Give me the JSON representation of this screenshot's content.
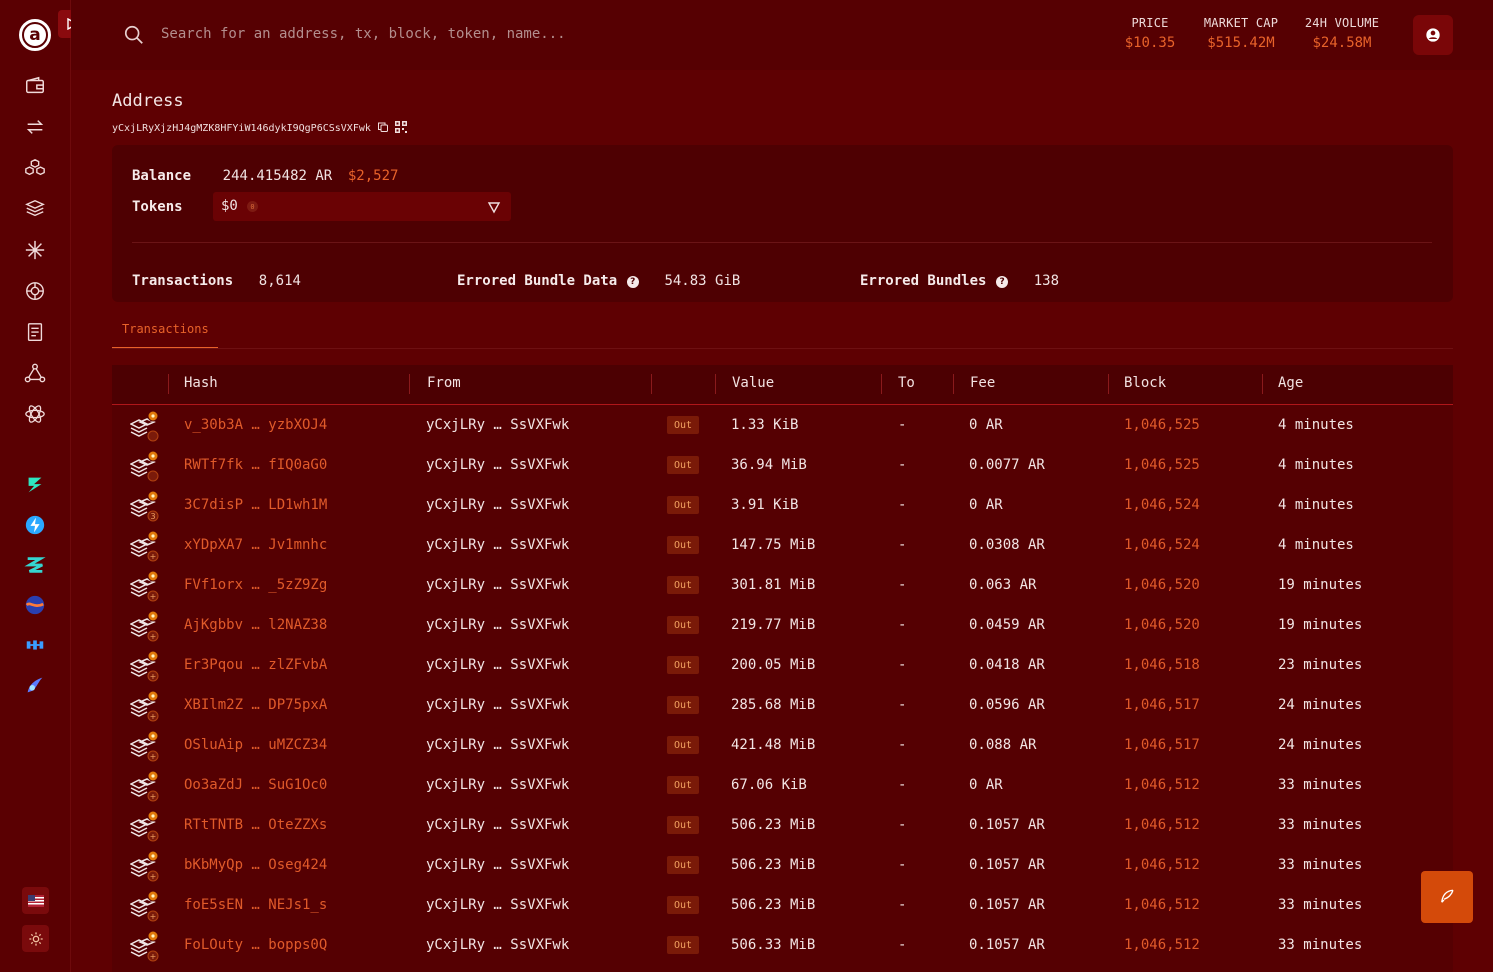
{
  "header": {
    "search_placeholder": "Search for an address, tx, block, token, name...",
    "stats": [
      {
        "label": "PRICE",
        "value": "$10.35"
      },
      {
        "label": "MARKET CAP",
        "value": "$515.42M"
      },
      {
        "label": "24H VOLUME",
        "value": "$24.58M"
      }
    ]
  },
  "sidebar": {
    "logo": "a",
    "nav_icons": [
      "wallet-icon",
      "transfer-icon",
      "cubes-icon",
      "layers-icon",
      "sparkle-icon",
      "target-icon",
      "document-icon",
      "network-icon",
      "atom-icon"
    ],
    "app_icons": [
      "bolt-app-icon",
      "lightning-app-icon",
      "stripes-app-icon",
      "wave-app-icon",
      "link-app-icon",
      "swirl-app-icon"
    ]
  },
  "page": {
    "title": "Address",
    "address": "yCxjLRyXjzHJ4gMZK8HFYiW146dykI9QgP6CSsVXFwk"
  },
  "summary": {
    "balance_label": "Balance",
    "balance_value": "244.415482 AR",
    "balance_usd": "$2,527",
    "tokens_label": "Tokens",
    "tokens_value": "$0",
    "tokens_badge": "0",
    "transactions_label": "Transactions",
    "transactions_value": "8,614",
    "errored_data_label": "Errored Bundle Data",
    "errored_data_value": "54.83 GiB",
    "errored_bundles_label": "Errored Bundles",
    "errored_bundles_value": "138"
  },
  "tabs": [
    "Transactions"
  ],
  "table": {
    "headers": {
      "hash": "Hash",
      "from": "From",
      "value": "Value",
      "to": "To",
      "fee": "Fee",
      "block": "Block",
      "age": "Age"
    },
    "rows": [
      {
        "hash": "v_30b3A … yzbXOJ4",
        "from": "yCxjLRy … SsVXFwk",
        "dir": "Out",
        "value": "1.33 KiB",
        "to": "-",
        "fee": "0 AR",
        "block": "1,046,525",
        "age": "4 minutes",
        "badge2": ""
      },
      {
        "hash": "RWTf7fk … fIQ0aG0",
        "from": "yCxjLRy … SsVXFwk",
        "dir": "Out",
        "value": "36.94 MiB",
        "to": "-",
        "fee": "0.0077 AR",
        "block": "1,046,525",
        "age": "4 minutes",
        "badge2": ""
      },
      {
        "hash": "3C7disP … LD1wh1M",
        "from": "yCxjLRy … SsVXFwk",
        "dir": "Out",
        "value": "3.91 KiB",
        "to": "-",
        "fee": "0 AR",
        "block": "1,046,524",
        "age": "4 minutes",
        "badge2": "3"
      },
      {
        "hash": "xYDpXA7 … Jv1mnhc",
        "from": "yCxjLRy … SsVXFwk",
        "dir": "Out",
        "value": "147.75 MiB",
        "to": "-",
        "fee": "0.0308 AR",
        "block": "1,046,524",
        "age": "4 minutes",
        "badge2": "+"
      },
      {
        "hash": "FVf1orx … _5zZ9Zg",
        "from": "yCxjLRy … SsVXFwk",
        "dir": "Out",
        "value": "301.81 MiB",
        "to": "-",
        "fee": "0.063 AR",
        "block": "1,046,520",
        "age": "19 minutes",
        "badge2": "+"
      },
      {
        "hash": "AjKgbbv … l2NAZ38",
        "from": "yCxjLRy … SsVXFwk",
        "dir": "Out",
        "value": "219.77 MiB",
        "to": "-",
        "fee": "0.0459 AR",
        "block": "1,046,520",
        "age": "19 minutes",
        "badge2": "+"
      },
      {
        "hash": "Er3Pqou … zlZFvbA",
        "from": "yCxjLRy … SsVXFwk",
        "dir": "Out",
        "value": "200.05 MiB",
        "to": "-",
        "fee": "0.0418 AR",
        "block": "1,046,518",
        "age": "23 minutes",
        "badge2": "+"
      },
      {
        "hash": "XBIlm2Z … DP75pxA",
        "from": "yCxjLRy … SsVXFwk",
        "dir": "Out",
        "value": "285.68 MiB",
        "to": "-",
        "fee": "0.0596 AR",
        "block": "1,046,517",
        "age": "24 minutes",
        "badge2": "+"
      },
      {
        "hash": "OSluAip … uMZCZ34",
        "from": "yCxjLRy … SsVXFwk",
        "dir": "Out",
        "value": "421.48 MiB",
        "to": "-",
        "fee": "0.088 AR",
        "block": "1,046,517",
        "age": "24 minutes",
        "badge2": "+"
      },
      {
        "hash": "Oo3aZdJ … SuG1Oc0",
        "from": "yCxjLRy … SsVXFwk",
        "dir": "Out",
        "value": "67.06 KiB",
        "to": "-",
        "fee": "0 AR",
        "block": "1,046,512",
        "age": "33 minutes",
        "badge2": "+"
      },
      {
        "hash": "RTtTNTB … OteZZXs",
        "from": "yCxjLRy … SsVXFwk",
        "dir": "Out",
        "value": "506.23 MiB",
        "to": "-",
        "fee": "0.1057 AR",
        "block": "1,046,512",
        "age": "33 minutes",
        "badge2": "+"
      },
      {
        "hash": "bKbMyQp … Oseg424",
        "from": "yCxjLRy … SsVXFwk",
        "dir": "Out",
        "value": "506.23 MiB",
        "to": "-",
        "fee": "0.1057 AR",
        "block": "1,046,512",
        "age": "33 minutes",
        "badge2": "+"
      },
      {
        "hash": "foE5sEN … NEJs1_s",
        "from": "yCxjLRy … SsVXFwk",
        "dir": "Out",
        "value": "506.23 MiB",
        "to": "-",
        "fee": "0.1057 AR",
        "block": "1,046,512",
        "age": "33 minutes",
        "badge2": "+"
      },
      {
        "hash": "FoLOuty … bopps0Q",
        "from": "yCxjLRy … SsVXFwk",
        "dir": "Out",
        "value": "506.33 MiB",
        "to": "-",
        "fee": "0.1057 AR",
        "block": "1,046,512",
        "age": "33 minutes",
        "badge2": "+"
      }
    ]
  },
  "colors": {
    "accent": "#e8622a",
    "background": "#5e0002",
    "surface": "#4e0002"
  }
}
